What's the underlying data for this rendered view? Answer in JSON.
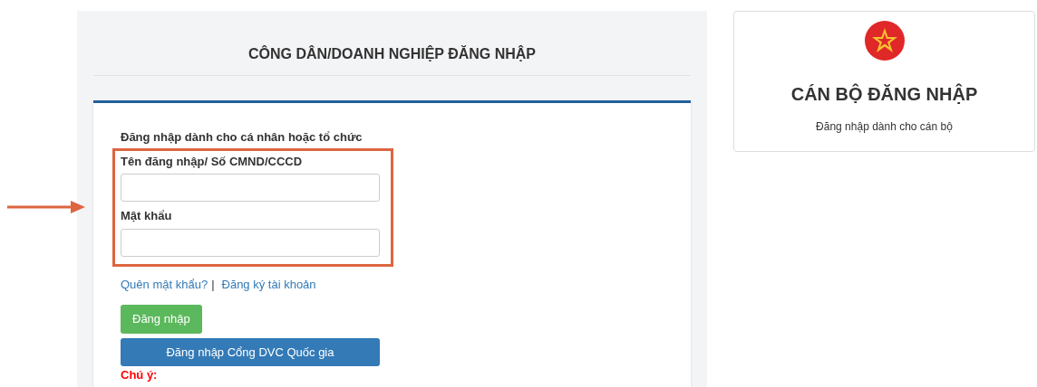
{
  "citizen_login": {
    "title": "CÔNG DÂN/DOANH NGHIỆP ĐĂNG NHẬP",
    "subtitle": "Đăng nhập dành cho cá nhân hoặc tổ chức",
    "fields": [
      {
        "label": "Tên đăng nhập/ Số CMND/CCCD"
      },
      {
        "label": "Mật khẩu"
      }
    ],
    "forgot_link": "Quên mật khẩu?",
    "separator": "|",
    "register_link": "Đăng ký tài khoản",
    "login_button": "Đăng nhập",
    "national_portal_button": "Đăng nhập Cổng DVC Quốc gia",
    "note_label": "Chú ý:"
  },
  "officer_login": {
    "title": "CÁN BỘ ĐĂNG NHẬP",
    "subtitle": "Đăng nhập dành cho cán bộ"
  }
}
